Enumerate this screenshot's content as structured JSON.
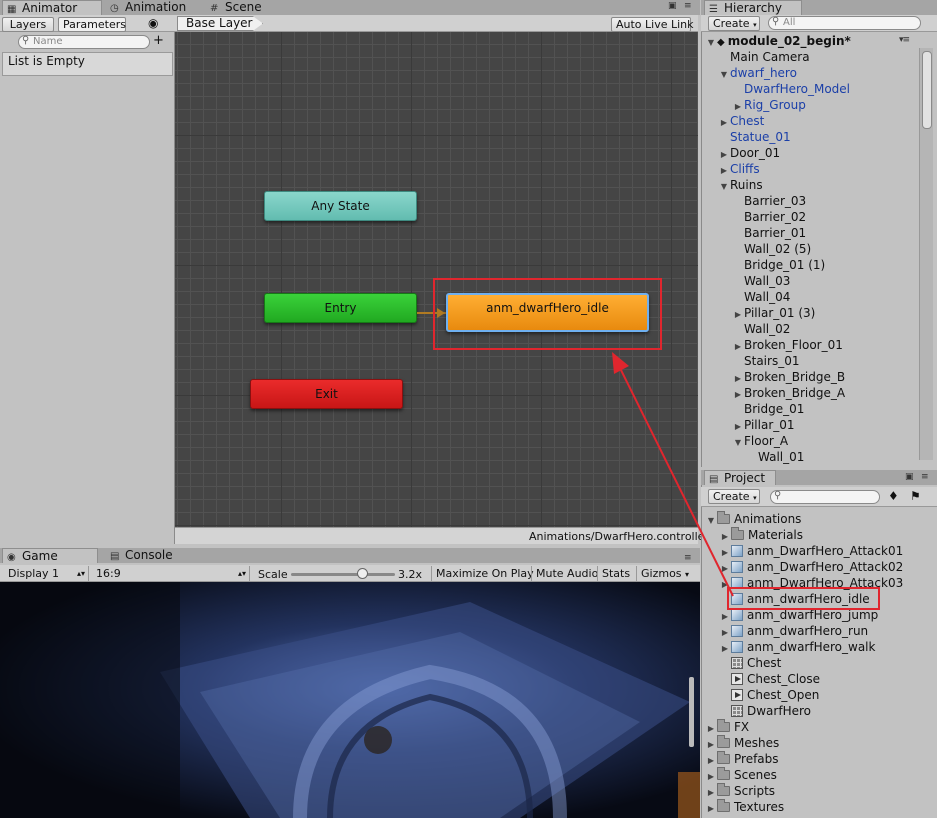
{
  "animator_tabs": {
    "animator": "Animator",
    "animation": "Animation",
    "scene": "Scene"
  },
  "left_panel": {
    "tab_layers": "Layers",
    "tab_parameters": "Parameters",
    "search_placeholder": "Name",
    "empty_text": "List is Empty"
  },
  "graph": {
    "breadcrumb": "Base Layer",
    "auto_live_link": "Auto Live Link",
    "path": "Animations/DwarfHero.controller",
    "nodes": {
      "any_state": "Any State",
      "entry": "Entry",
      "exit": "Exit",
      "idle": "anm_dwarfHero_idle"
    },
    "colors": {
      "any_state": "#6fc6b9",
      "entry": "#2bb92b",
      "exit": "#d62020",
      "idle": "#f29a1c",
      "highlight": "#e0262e"
    }
  },
  "game": {
    "tab_game": "Game",
    "tab_console": "Console",
    "display": "Display 1",
    "aspect": "16:9",
    "scale_label": "Scale",
    "scale_value": "3.2x",
    "maximize_on_play": "Maximize On Play",
    "mute_audio": "Mute Audio",
    "stats": "Stats",
    "gizmos": "Gizmos"
  },
  "hierarchy": {
    "tab": "Hierarchy",
    "create": "Create",
    "search_placeholder": "All",
    "scene": "module_02_begin*",
    "items": [
      {
        "label": "Main Camera"
      },
      {
        "label": "dwarf_hero"
      },
      {
        "label": "DwarfHero_Model"
      },
      {
        "label": "Rig_Group"
      },
      {
        "label": "Chest"
      },
      {
        "label": "Statue_01"
      },
      {
        "label": "Door_01"
      },
      {
        "label": "Cliffs"
      },
      {
        "label": "Ruins"
      },
      {
        "label": "Barrier_03"
      },
      {
        "label": "Barrier_02"
      },
      {
        "label": "Barrier_01"
      },
      {
        "label": "Wall_02 (5)"
      },
      {
        "label": "Bridge_01 (1)"
      },
      {
        "label": "Wall_03"
      },
      {
        "label": "Wall_04"
      },
      {
        "label": "Pillar_01 (3)"
      },
      {
        "label": "Wall_02"
      },
      {
        "label": "Broken_Floor_01"
      },
      {
        "label": "Stairs_01"
      },
      {
        "label": "Broken_Bridge_B"
      },
      {
        "label": "Broken_Bridge_A"
      },
      {
        "label": "Bridge_01"
      },
      {
        "label": "Pillar_01"
      },
      {
        "label": "Floor_A"
      },
      {
        "label": "Wall_01"
      }
    ]
  },
  "project": {
    "tab": "Project",
    "create": "Create",
    "items": [
      {
        "label": "Animations"
      },
      {
        "label": "Materials"
      },
      {
        "label": "anm_DwarfHero_Attack01"
      },
      {
        "label": "anm_DwarfHero_Attack02"
      },
      {
        "label": "anm_DwarfHero_Attack03"
      },
      {
        "label": "anm_dwarfHero_idle"
      },
      {
        "label": "anm_dwarfHero_jump"
      },
      {
        "label": "anm_dwarfHero_run"
      },
      {
        "label": "anm_dwarfHero_walk"
      },
      {
        "label": "Chest"
      },
      {
        "label": "Chest_Close"
      },
      {
        "label": "Chest_Open"
      },
      {
        "label": "DwarfHero"
      },
      {
        "label": "FX"
      },
      {
        "label": "Meshes"
      },
      {
        "label": "Prefabs"
      },
      {
        "label": "Scenes"
      },
      {
        "label": "Scripts"
      },
      {
        "label": "Textures"
      }
    ]
  }
}
